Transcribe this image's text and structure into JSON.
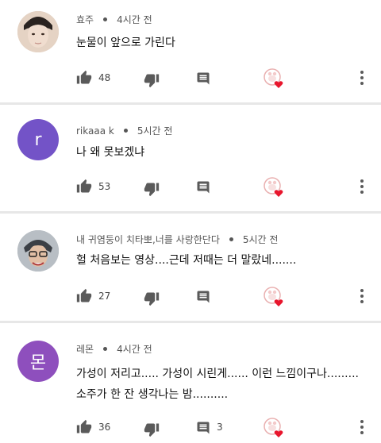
{
  "colors": {
    "avatar_r": "#7353c7",
    "avatar_mon": "#8e4fbd",
    "heart": "#e8162d",
    "icon": "#5a5a5a"
  },
  "comments": [
    {
      "author": "효주",
      "time": "4시간 전",
      "lines": [
        "눈물이 앞으로 가린다"
      ],
      "likes": "48",
      "replies": ""
    },
    {
      "author": "rikaaa k",
      "avatar_letter": "r",
      "time": "5시간 전",
      "lines": [
        "나 왜 못보겠냐"
      ],
      "likes": "53",
      "replies": ""
    },
    {
      "author": "내 귀염둥이 치타뽀,너를 사랑한단다",
      "time": "5시간 전",
      "lines": [
        "헐 처음보는 영상....근데 저때는 더 말랐네......."
      ],
      "likes": "27",
      "replies": ""
    },
    {
      "author": "레몬",
      "avatar_letter": "몬",
      "time": "4시간 전",
      "lines": [
        "가성이 저리고..... 가성이 시린게...... 이런 느낌이구나.........",
        "소주가 한 잔 생각나는 밤.........."
      ],
      "likes": "36",
      "replies": "3"
    }
  ]
}
